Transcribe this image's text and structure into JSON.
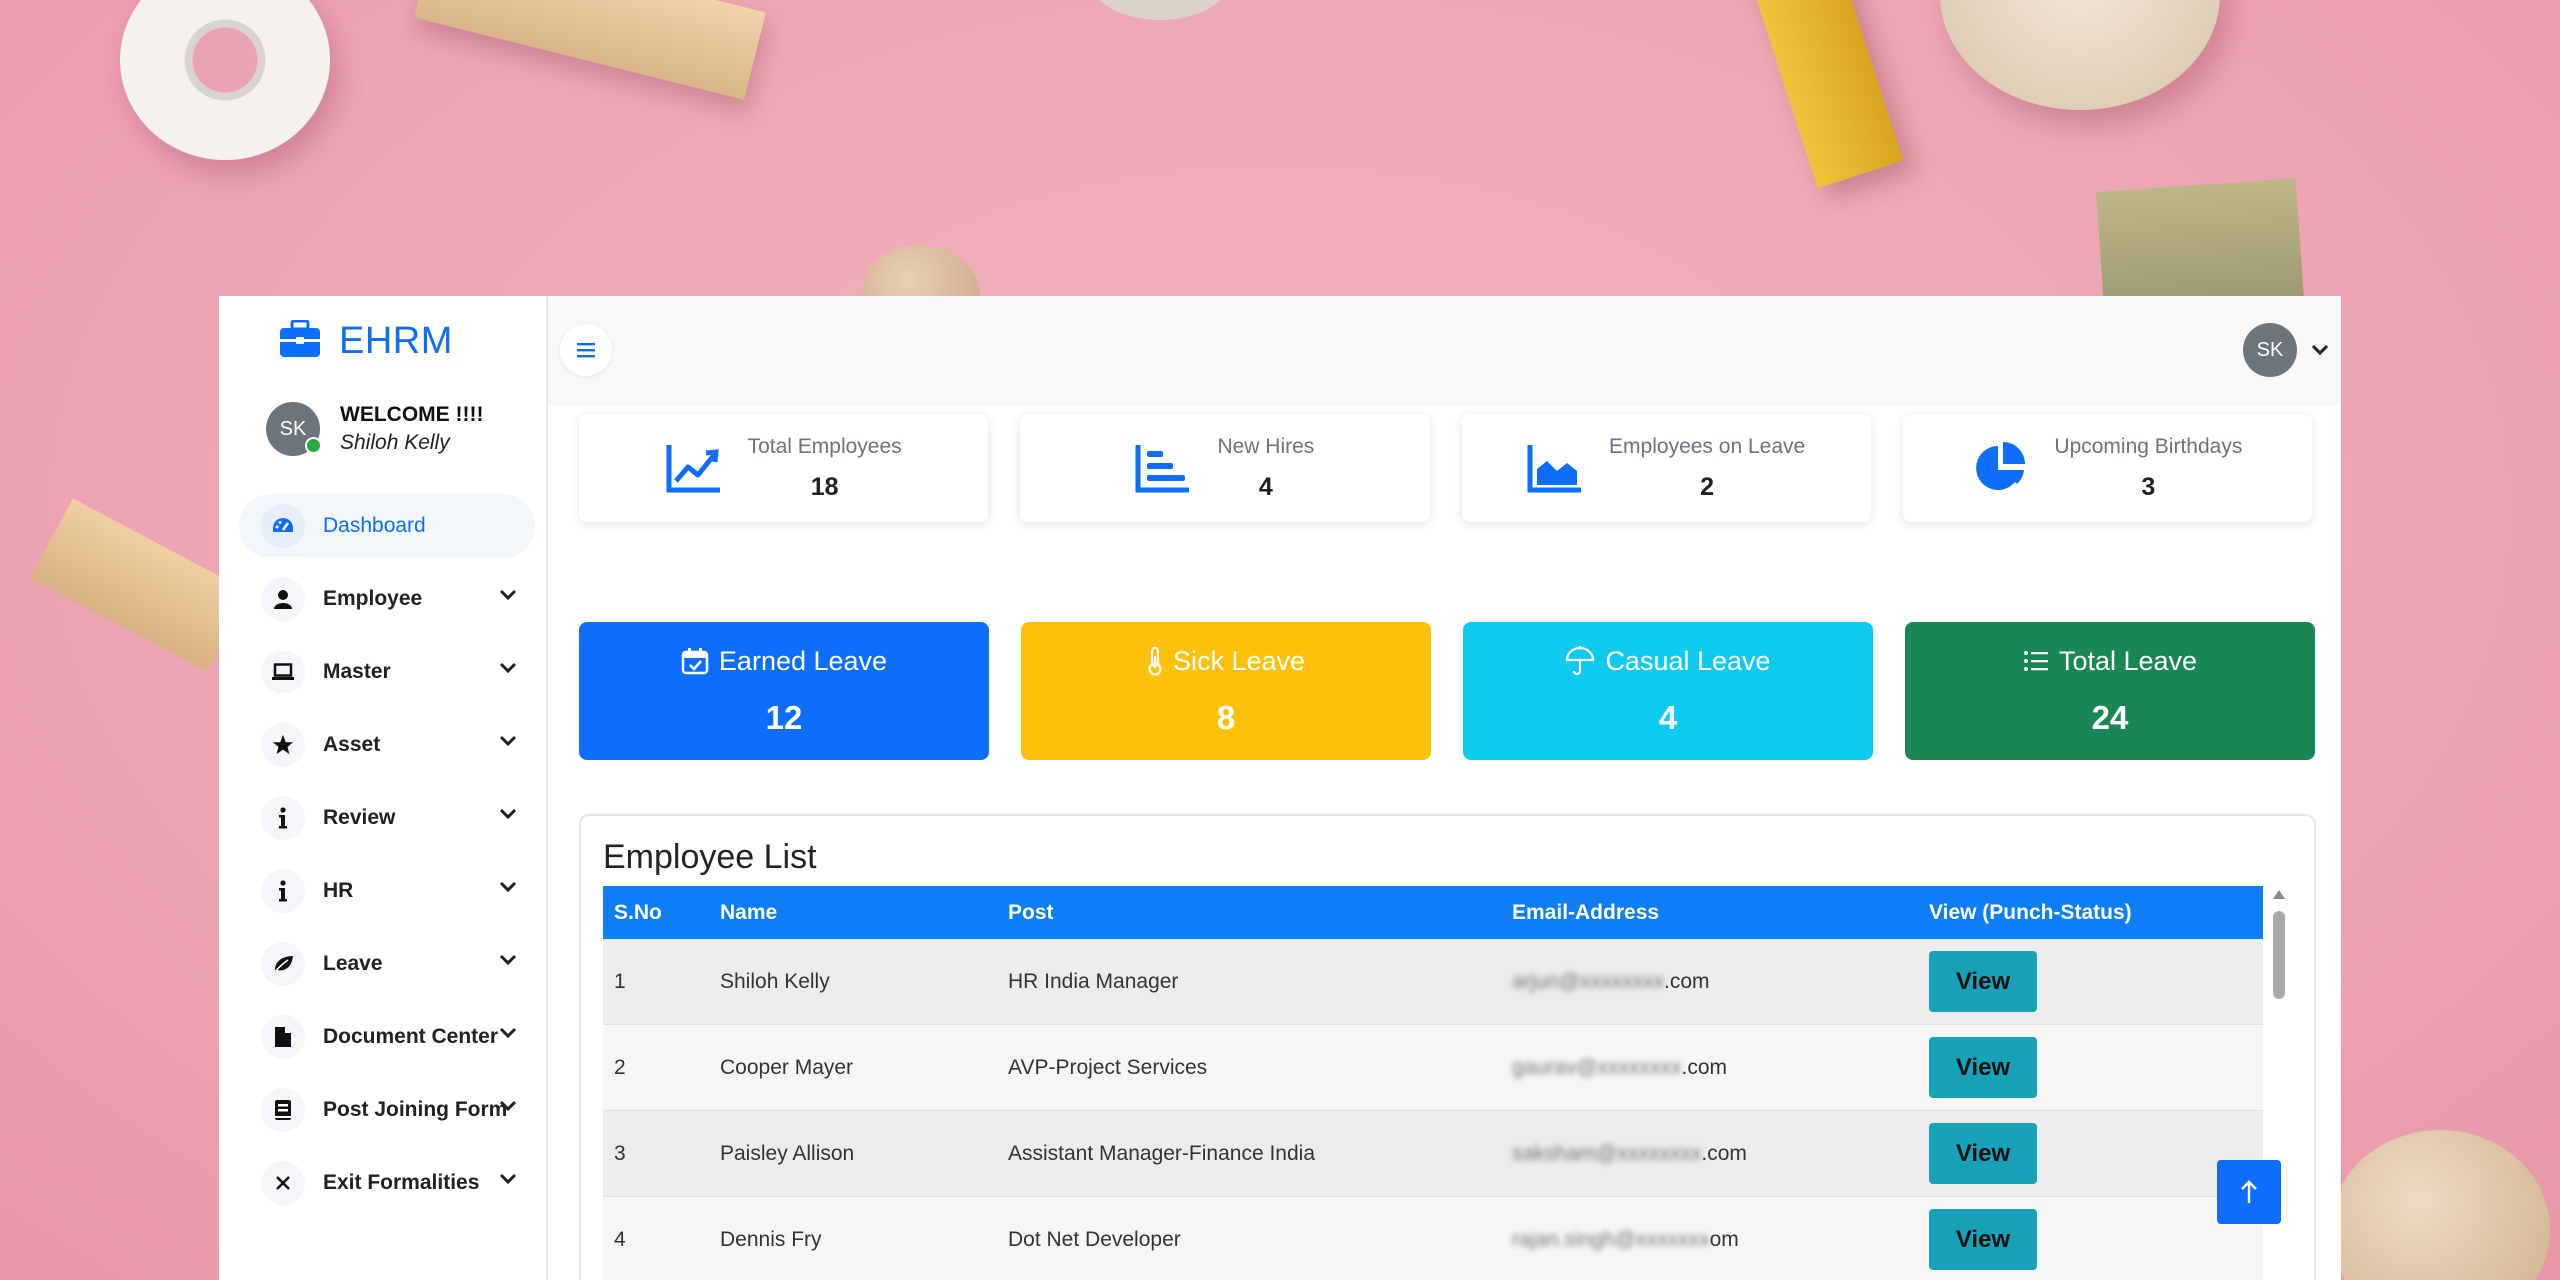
{
  "brand": {
    "name": "EHRM"
  },
  "welcome": {
    "greeting": "WELCOME !!!!",
    "user_name": "Shiloh Kelly",
    "initials": "SK"
  },
  "sidebar": {
    "items": [
      {
        "label": "Dashboard",
        "icon": "gauge-icon",
        "active": true
      },
      {
        "label": "Employee",
        "icon": "person-icon"
      },
      {
        "label": "Master",
        "icon": "laptop-icon"
      },
      {
        "label": "Asset",
        "icon": "star-icon"
      },
      {
        "label": "Review",
        "icon": "info-icon"
      },
      {
        "label": "HR",
        "icon": "info-icon"
      },
      {
        "label": "Leave",
        "icon": "leaf-icon"
      },
      {
        "label": "Document Center",
        "icon": "file-icon"
      },
      {
        "label": "Post Joining Form",
        "icon": "book-icon"
      },
      {
        "label": "Exit Formalities",
        "icon": "close-icon"
      }
    ]
  },
  "topbar": {
    "user_initials": "SK"
  },
  "stats": [
    {
      "label": "Total Employees",
      "value": "18",
      "icon": "line-chart-icon"
    },
    {
      "label": "New Hires",
      "value": "4",
      "icon": "bar-chart-icon"
    },
    {
      "label": "Employees on Leave",
      "value": "2",
      "icon": "area-chart-icon"
    },
    {
      "label": "Upcoming Birthdays",
      "value": "3",
      "icon": "pie-chart-icon"
    }
  ],
  "leaves": [
    {
      "label": "Earned Leave",
      "value": "12",
      "color": "#0d6efd",
      "icon": "calendar-check-icon"
    },
    {
      "label": "Sick Leave",
      "value": "8",
      "color": "#ffc107",
      "icon": "thermometer-icon"
    },
    {
      "label": "Casual Leave",
      "value": "4",
      "color": "#0dcaf0",
      "icon": "umbrella-icon"
    },
    {
      "label": "Total Leave",
      "value": "24",
      "color": "#198754",
      "icon": "list-icon"
    }
  ],
  "employee_list": {
    "title": "Employee List",
    "columns": [
      "S.No",
      "Name",
      "Post",
      "Email-Address",
      "View (Punch-Status)"
    ],
    "rows": [
      {
        "sno": "1",
        "name": "Shiloh Kelly",
        "post": "HR India Manager",
        "email_hidden": "arjun@xxxxxxxx",
        "email_suffix": ".com",
        "action": "View"
      },
      {
        "sno": "2",
        "name": "Cooper Mayer",
        "post": "AVP-Project Services",
        "email_hidden": "gaurav@xxxxxxxx",
        "email_suffix": ".com",
        "action": "View"
      },
      {
        "sno": "3",
        "name": "Paisley Allison",
        "post": "Assistant Manager-Finance India",
        "email_hidden": "saksham@xxxxxxxx",
        "email_suffix": ".com",
        "action": "View"
      },
      {
        "sno": "4",
        "name": "Dennis Fry",
        "post": "Dot Net Developer",
        "email_hidden": "rajan.singh@xxxxxxx",
        "email_suffix": "om",
        "action": "View"
      }
    ]
  }
}
